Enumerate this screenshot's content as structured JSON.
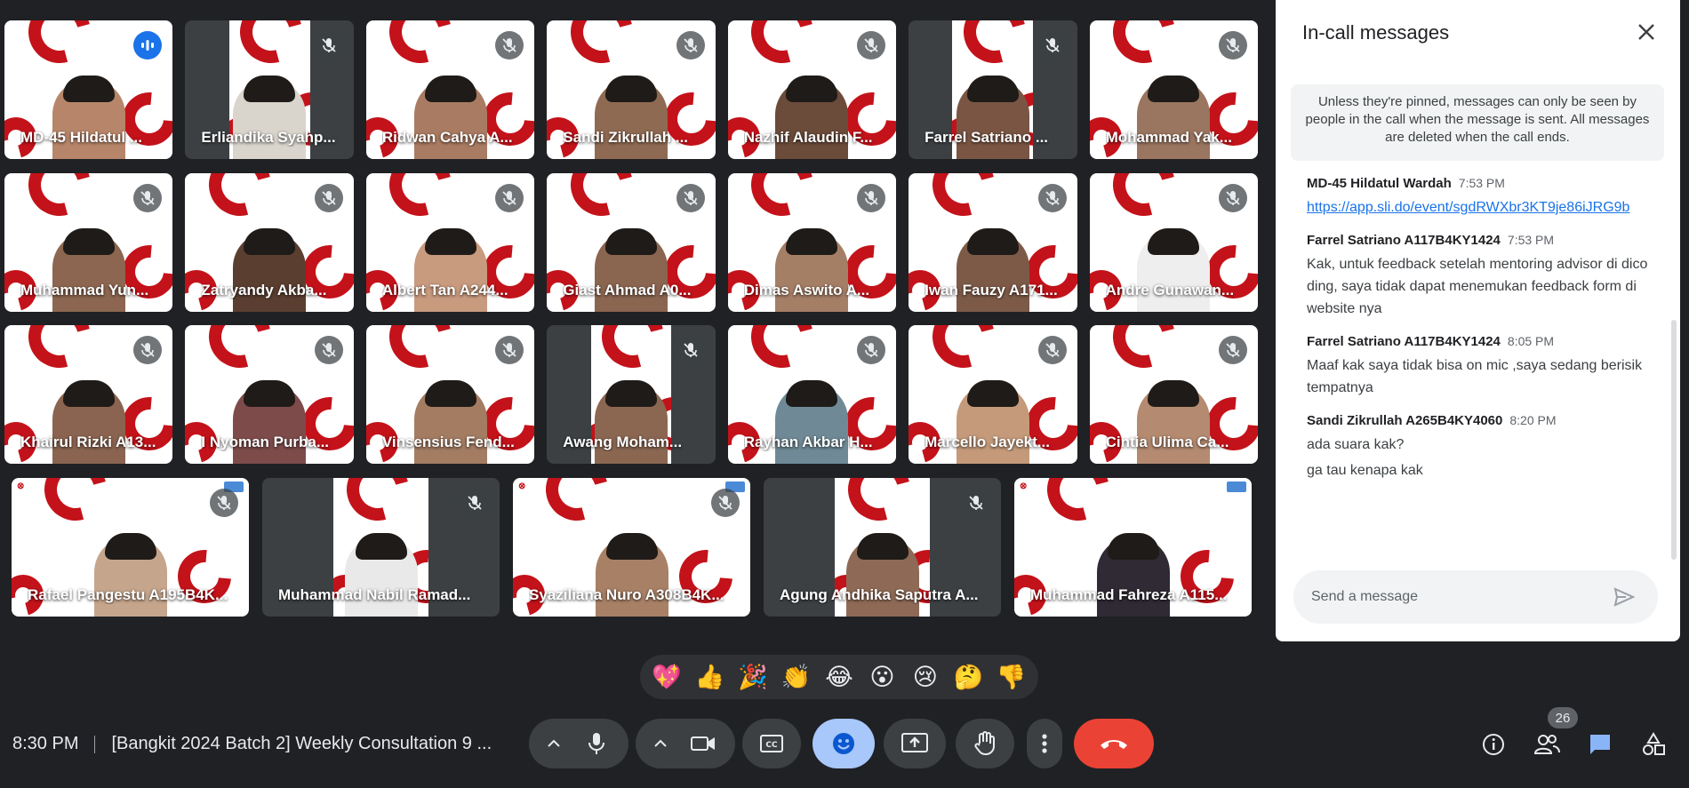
{
  "colors": {
    "background": "#202124",
    "tile_dark": "#3c4043",
    "speaking_blue": "#8ab4f8",
    "end_call_red": "#ea4335",
    "logo_red": "#c4121a",
    "panel_bg": "#ffffff",
    "link_blue": "#1a73e8"
  },
  "participants": [
    [
      {
        "name": "MD-45 Hildatul ...",
        "muted": false,
        "speaking": true,
        "style": "full",
        "skin": "#b7866a"
      },
      {
        "name": "Erliandika Syahp...",
        "muted": true,
        "style": "strip",
        "skin": "#d9d4cc"
      },
      {
        "name": "Ridwan Cahya A...",
        "muted": true,
        "style": "full",
        "skin": "#a97b62"
      },
      {
        "name": "Sandi Zikrullah ...",
        "muted": true,
        "style": "full",
        "skin": "#8f6a52"
      },
      {
        "name": "Nazhif Alaudin F...",
        "muted": true,
        "style": "full",
        "skin": "#6b4b3a"
      },
      {
        "name": "Farrel Satriano ...",
        "muted": true,
        "style": "strip",
        "skin": "#7a5543"
      },
      {
        "name": "Mohammad Yak...",
        "muted": true,
        "style": "full",
        "skin": "#9a7560"
      }
    ],
    [
      {
        "name": "Muhammad Yun...",
        "muted": true,
        "style": "full",
        "skin": "#8c6650"
      },
      {
        "name": "Zatryandy Akba...",
        "muted": true,
        "style": "full",
        "skin": "#5a3e30"
      },
      {
        "name": "Albert Tan A244...",
        "muted": true,
        "style": "full",
        "skin": "#c89a7e"
      },
      {
        "name": "Giast Ahmad A0...",
        "muted": true,
        "style": "full",
        "skin": "#8a6550"
      },
      {
        "name": "Dimas Aswito A...",
        "muted": true,
        "style": "full",
        "skin": "#a57e66"
      },
      {
        "name": "Iwan Fauzy A171...",
        "muted": true,
        "style": "full",
        "skin": "#7d5a48"
      },
      {
        "name": "Andre Gunawan...",
        "muted": true,
        "style": "full",
        "skin": "#eeeeee"
      }
    ],
    [
      {
        "name": "Khairul Rizki A13...",
        "muted": true,
        "style": "full",
        "skin": "#8a6450"
      },
      {
        "name": "I Nyoman Purba...",
        "muted": true,
        "style": "full",
        "skin": "#7e4b4b"
      },
      {
        "name": "Vinsensius Fend...",
        "muted": true,
        "style": "full",
        "skin": "#a37c62"
      },
      {
        "name": "Awang Moham...",
        "muted": true,
        "style": "strip",
        "skin": "#8b6752"
      },
      {
        "name": "Rayhan Akbar H...",
        "muted": true,
        "style": "full",
        "skin": "#6f8a96"
      },
      {
        "name": "Marcello Jayekt...",
        "muted": true,
        "style": "full",
        "skin": "#c49a7a"
      },
      {
        "name": "Cintia Ulima Ca...",
        "muted": true,
        "style": "full",
        "skin": "#b48a70"
      }
    ],
    [
      {
        "name": "Rafael Pangestu A195B4K...",
        "muted": true,
        "style": "full",
        "skin": "#c5a58c",
        "bangkit": true
      },
      {
        "name": "Muhammad Nabil Ramad...",
        "muted": true,
        "style": "strip2",
        "skin": "#e9e9e9"
      },
      {
        "name": "Syaziliana Nuro A308B4K...",
        "muted": true,
        "style": "full",
        "skin": "#a88066",
        "bangkit": true
      },
      {
        "name": "Agung Andhika Saputra A...",
        "muted": true,
        "style": "strip2",
        "skin": "#8e6a56"
      },
      {
        "name": "Muhammad Fahreza A115...",
        "muted": null,
        "style": "full",
        "skin": "#2f2a33",
        "bangkit": true
      }
    ]
  ],
  "reactions": [
    "💖",
    "👍",
    "🎉",
    "👏",
    "😂",
    "😮",
    "😢",
    "🤔",
    "👎"
  ],
  "meeting": {
    "time": "8:30 PM",
    "title": "[Bangkit 2024 Batch 2] Weekly Consultation 9 ..."
  },
  "controls": {
    "mic_icon": "mic-icon",
    "camera_icon": "camera-icon",
    "captions_icon": "captions-icon",
    "emoji_icon": "emoji-icon",
    "present_icon": "present-icon",
    "raise_hand_icon": "raise-hand-icon",
    "more_icon": "more-vert-icon",
    "end_call_icon": "end-call-icon"
  },
  "right_controls": {
    "participant_count": "26"
  },
  "panel": {
    "title": "In-call messages",
    "notice": "Unless they're pinned, messages can only be seen by people in the call when the message is sent. All messages are deleted when the call ends.",
    "messages": [
      {
        "sender": "MD-45 Hildatul Wardah",
        "time": "7:53 PM",
        "lines": [
          {
            "text": "https://app.sli.do/event/sgdRWXbr3KT9je86iJRG9b",
            "link": true
          }
        ]
      },
      {
        "sender": "Farrel Satriano A117B4KY1424",
        "time": "7:53 PM",
        "lines": [
          {
            "text": "Kak, untuk feedback setelah mentoring advisor di dicoding, saya tidak dapat menemukan feedback form di website nya",
            "link": false
          }
        ]
      },
      {
        "sender": "Farrel Satriano A117B4KY1424",
        "time": "8:05 PM",
        "lines": [
          {
            "text": "Maaf kak saya tidak bisa on mic ,saya sedang berisik tempatnya",
            "link": false
          }
        ]
      },
      {
        "sender": "Sandi Zikrullah A265B4KY4060",
        "time": "8:20 PM",
        "lines": [
          {
            "text": "ada suara kak?",
            "link": false
          },
          {
            "text": "ga tau kenapa kak",
            "link": false
          }
        ]
      }
    ],
    "send_placeholder": "Send a message"
  }
}
